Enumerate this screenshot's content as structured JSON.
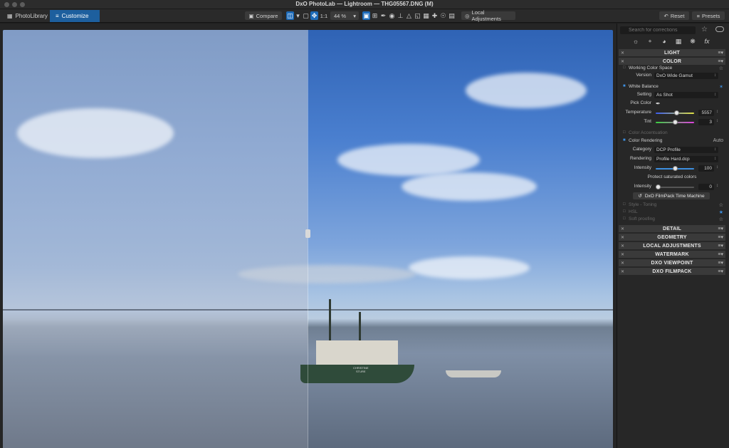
{
  "window": {
    "title": "DxO PhotoLab — Lightroom — THG05567.DNG (M)"
  },
  "toolbar": {
    "tabs": [
      {
        "label": "PhotoLibrary",
        "icon": "grid-icon"
      },
      {
        "label": "Customize",
        "icon": "sliders-icon"
      }
    ],
    "compare_label": "Compare",
    "zoom_one_to_one": "1:1",
    "zoom_value": "44 %",
    "local_adjustments_label": "Local Adjustments",
    "reset_label": "Reset",
    "presets_label": "Presets"
  },
  "photo": {
    "boat_text_line1": "CHRISTINE",
    "boat_text_line2": "STURE"
  },
  "panel": {
    "search_placeholder": "Search for corrections",
    "sections": {
      "light": "LIGHT",
      "color": "COLOR",
      "detail": "DETAIL",
      "geometry": "GEOMETRY",
      "local_adjustments": "LOCAL ADJUSTMENTS",
      "watermark": "WATERMARK",
      "dxo_viewpoint": "DXO VIEWPOINT",
      "dxo_filmpack": "DXO FILMPACK"
    },
    "color": {
      "working_color_space": "Working Color Space",
      "version_label": "Version",
      "version_value": "DxO Wide Gamut",
      "white_balance": "White Balance",
      "setting_label": "Setting",
      "setting_value": "As Shot",
      "pick_color_label": "Pick Color",
      "temperature_label": "Temperature",
      "temperature_value": "5557",
      "temperature_pos": 0.56,
      "tint_label": "Tint",
      "tint_value": "3",
      "tint_pos": 0.51,
      "color_accentuation": "Color Accentuation",
      "color_rendering": "Color Rendering",
      "color_rendering_mode": "Auto",
      "category_label": "Category",
      "category_value": "DCP Profile",
      "rendering_label": "Rendering",
      "rendering_value": "Profile Hard.dcp",
      "intensity_label": "Intensity",
      "intensity_value": "100",
      "intensity_pos": 0.5,
      "protect_saturated": "Protect saturated colors",
      "protect_intensity_label": "Intensity",
      "protect_intensity_value": "0",
      "protect_intensity_pos": 0.0,
      "filmpack_button": "DxO FilmPack Time Machine",
      "style_toning": "Style - Toning",
      "hsl": "HSL",
      "soft_proofing": "Soft proofing"
    }
  },
  "colors": {
    "accent": "#1e6bb8",
    "panel_bg": "#272727",
    "section_bg": "#3a3a3a"
  }
}
